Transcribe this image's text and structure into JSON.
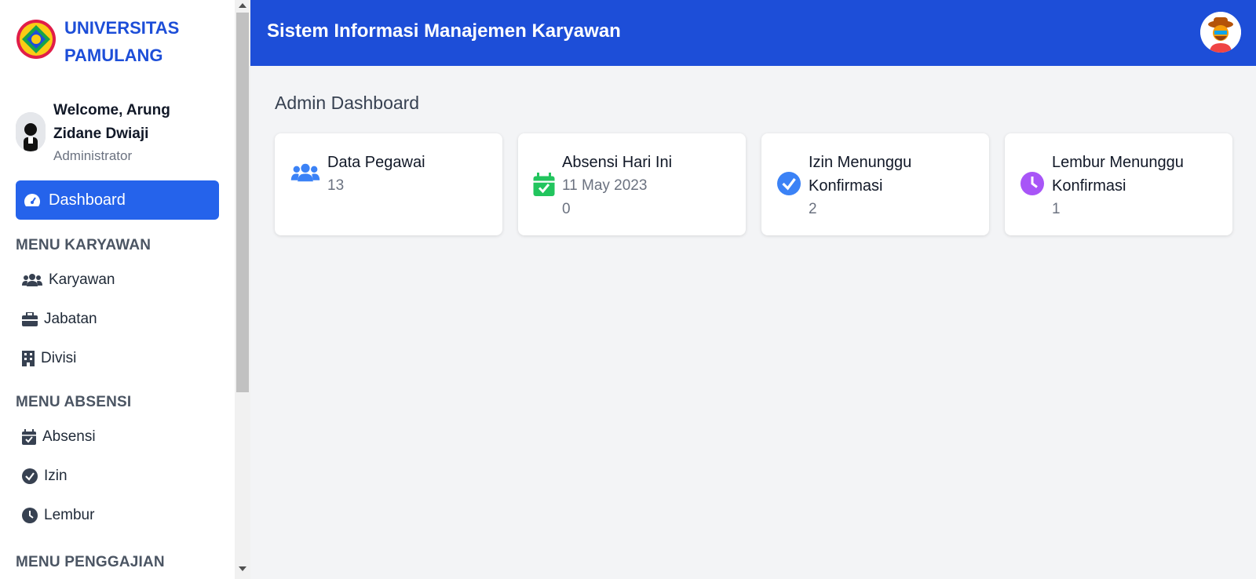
{
  "sidebar": {
    "brand_line1": "UNIVERSITAS",
    "brand_line2": "PAMULANG",
    "welcome": "Welcome, Arung Zidane Dwiaji",
    "role": "Administrator",
    "active_item": "Dashboard",
    "sections": [
      {
        "title": "MENU KARYAWAN",
        "items": [
          {
            "label": "Karyawan",
            "icon": "users-icon"
          },
          {
            "label": "Jabatan",
            "icon": "briefcase-icon"
          },
          {
            "label": "Divisi",
            "icon": "building-icon"
          }
        ]
      },
      {
        "title": "MENU ABSENSI",
        "items": [
          {
            "label": "Absensi",
            "icon": "calendar-check-icon"
          },
          {
            "label": "Izin",
            "icon": "check-circle-icon"
          },
          {
            "label": "Lembur",
            "icon": "clock-icon"
          }
        ]
      },
      {
        "title": "MENU PENGGAJIAN",
        "items": []
      }
    ]
  },
  "header": {
    "title": "Sistem Informasi Manajemen Karyawan"
  },
  "main": {
    "title": "Admin Dashboard",
    "cards": [
      {
        "title": "Data Pegawai",
        "lines": [
          "13"
        ],
        "icon": "users-icon",
        "color": "#3b82f6"
      },
      {
        "title": "Absensi Hari Ini",
        "lines": [
          "11 May 2023",
          "0"
        ],
        "icon": "calendar-check-icon",
        "color": "#22c55e"
      },
      {
        "title": "Izin Menunggu Konfirmasi",
        "lines": [
          "2"
        ],
        "icon": "check-circle-icon",
        "color": "#3b82f6"
      },
      {
        "title": "Lembur Menunggu Konfirmasi",
        "lines": [
          "1"
        ],
        "icon": "clock-icon",
        "color": "#a855f7"
      }
    ]
  },
  "colors": {
    "header": "#1d4ed8",
    "active_nav": "#2563eb",
    "brand_text": "#1d4ed8"
  }
}
